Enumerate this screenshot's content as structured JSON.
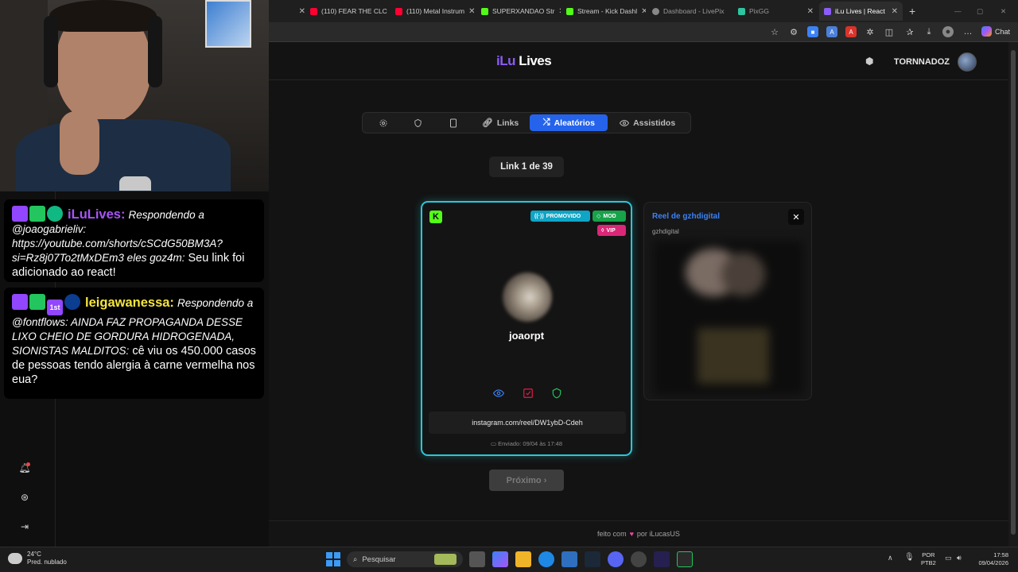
{
  "browser": {
    "tabs": [
      {
        "label": "(110) FEAR THE CLC",
        "color": "#ff0033"
      },
      {
        "label": "(110) Metal Instrum",
        "color": "#ff0033"
      },
      {
        "label": "SUPERXANDAO Str",
        "color": "#53fc18"
      },
      {
        "label": "Stream - Kick Dashl",
        "color": "#53fc18"
      },
      {
        "label": "Dashboard - LivePix",
        "color": "#888888"
      },
      {
        "label": "PixGG",
        "color": "#2cc6a0"
      },
      {
        "label": "iLu Lives | React",
        "color": "#8b5cf6"
      }
    ],
    "chat_label": "Chat"
  },
  "app": {
    "logo_i": "iLu",
    "logo_rest": "Lives",
    "user_name": "TORNNADOZ",
    "nav": [
      {
        "label": "",
        "icon": "gear-icon"
      },
      {
        "label": "",
        "icon": "shield-icon"
      },
      {
        "label": "",
        "icon": "tablet-icon"
      },
      {
        "label": "Links",
        "icon": "link-icon"
      },
      {
        "label": "Aleatórios",
        "icon": "shuffle-icon"
      },
      {
        "label": "Assistidos",
        "icon": "eye-icon"
      }
    ],
    "counter": "Link 1 de 39",
    "card": {
      "badge_promoted": "PROMOVIDO",
      "badge_mod": "MOD",
      "badge_vip": "VIP",
      "username": "joaorpt",
      "link": "instagram.com/reel/DW1ybD-Cdeh",
      "sent": "Enviado: 09/04 às 17:48"
    },
    "preview": {
      "title": "Reel de gzhdigital",
      "subtitle": "gzhdigital"
    },
    "next_label": "Próximo ›",
    "footer_pre": "feito com",
    "footer_post": "por iLucasUS",
    "colors": {
      "accent": "#2563eb",
      "card_border": "#2cc6d6",
      "kick": "#53fc18"
    }
  },
  "chat": [
    {
      "user": "iLuLives:",
      "italic": "Respondendo a @joaogabrieliv: https://youtube.com/shorts/cSCdG50BM3A?si=Rz8j07To2tMxDEm3 eles goz4m:",
      "text": "Seu link foi adicionado ao react!"
    },
    {
      "user": "leigawanessa:",
      "italic": "Respondendo a @fontflows: AINDA FAZ PROPAGANDA DESSE LIXO CHEIO DE GORDURA HIDROGENADA, SIONISTAS MALDITOS:",
      "text": "cê viu os 450.000 casos de pessoas tendo alergia à carne vermelha nos eua?"
    }
  ],
  "taskbar": {
    "weather_temp": "24°C",
    "weather_desc": "Pred. nublado",
    "search": "Pesquisar",
    "lang1": "POR",
    "lang2": "PTB2",
    "time": "17:58",
    "date": "09/04/2026"
  }
}
